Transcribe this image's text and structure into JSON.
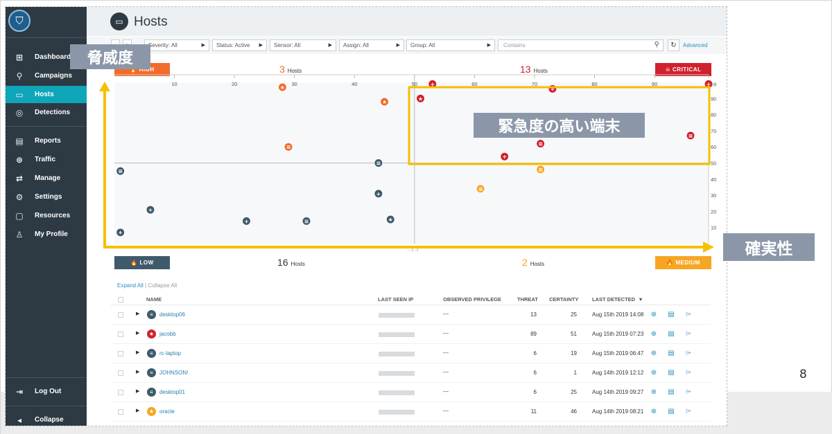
{
  "sidebar": {
    "logo_icon": "shield-logo-icon",
    "items": [
      {
        "label": "Dashboard",
        "icon": "dashboard-icon",
        "glyph": "⊞"
      },
      {
        "label": "Campaigns",
        "icon": "campaigns-icon",
        "glyph": "⚲"
      },
      {
        "label": "Hosts",
        "icon": "monitor-icon",
        "glyph": "▭",
        "active": true
      },
      {
        "label": "Detections",
        "icon": "target-icon",
        "glyph": "◎"
      },
      {
        "label": "Reports",
        "icon": "report-icon",
        "glyph": "▤"
      },
      {
        "label": "Traffic",
        "icon": "traffic-icon",
        "glyph": "⊛"
      },
      {
        "label": "Manage",
        "icon": "manage-icon",
        "glyph": "⇄"
      },
      {
        "label": "Settings",
        "icon": "gear-icon",
        "glyph": "⚙"
      },
      {
        "label": "Resources",
        "icon": "book-icon",
        "glyph": "▢"
      },
      {
        "label": "My Profile",
        "icon": "user-icon",
        "glyph": "♙"
      }
    ],
    "logout": {
      "label": "Log Out",
      "icon": "logout-icon",
      "glyph": "⇥"
    },
    "collapse": {
      "label": "Collapse",
      "icon": "collapse-icon",
      "glyph": "◂"
    }
  },
  "header": {
    "title": "Hosts",
    "icon": "monitor-icon"
  },
  "filters": {
    "star_icon": "star-icon",
    "target_icon": "target-icon",
    "severity": "Severity: All",
    "status": "Status: Active",
    "sensor": "Sensor: All",
    "assign": "Assign: All",
    "group": "Group: All",
    "search_placeholder": "Contains",
    "advanced": "Advanced"
  },
  "quadrants": {
    "high": {
      "label": "HIGH",
      "count": "3",
      "unit": "Hosts",
      "color": "#f26b2c"
    },
    "critical": {
      "label": "CRITICAL",
      "count": "13",
      "unit": "Hosts",
      "color": "#d0212e"
    },
    "low": {
      "label": "LOW",
      "count": "16",
      "unit": "Hosts",
      "color": "#3e5a6b"
    },
    "medium": {
      "label": "MEDIUM",
      "count": "2",
      "unit": "Hosts",
      "color": "#f6a623"
    }
  },
  "chart_data": {
    "type": "scatter",
    "x_ticks": [
      "10",
      "20",
      "30",
      "40",
      "50",
      "60",
      "70",
      "80",
      "90",
      "99"
    ],
    "y_ticks": [
      "99",
      "90",
      "80",
      "70",
      "60",
      "50",
      "40",
      "30",
      "20",
      "10"
    ],
    "xlim": [
      0,
      99
    ],
    "ylim": [
      0,
      100
    ],
    "xlabel": "",
    "partial_label": "... (...)",
    "points": [
      {
        "x": 28,
        "y": 97,
        "sev": "high",
        "icon": "star-icon"
      },
      {
        "x": 45,
        "y": 88,
        "sev": "high",
        "icon": "star-icon"
      },
      {
        "x": 29,
        "y": 60,
        "sev": "high",
        "icon": "server-icon"
      },
      {
        "x": 53,
        "y": 99,
        "sev": "critical",
        "icon": "plus-icon"
      },
      {
        "x": 51,
        "y": 90,
        "sev": "critical",
        "icon": "star-icon"
      },
      {
        "x": 73,
        "y": 96,
        "sev": "critical",
        "icon": "plus-icon"
      },
      {
        "x": 99,
        "y": 99,
        "sev": "critical",
        "icon": "plus-icon"
      },
      {
        "x": 71,
        "y": 62,
        "sev": "critical",
        "icon": "server-icon"
      },
      {
        "x": 96,
        "y": 67,
        "sev": "critical",
        "icon": "server-icon"
      },
      {
        "x": 65,
        "y": 54,
        "sev": "critical",
        "icon": "plus-icon"
      },
      {
        "x": 71,
        "y": 46,
        "sev": "medium",
        "icon": "server-icon"
      },
      {
        "x": 61,
        "y": 34,
        "sev": "medium",
        "icon": "server-icon"
      },
      {
        "x": 1,
        "y": 45,
        "sev": "low",
        "icon": "server-icon"
      },
      {
        "x": 44,
        "y": 50,
        "sev": "low",
        "icon": "server-icon"
      },
      {
        "x": 6,
        "y": 21,
        "sev": "low",
        "icon": "plus-icon"
      },
      {
        "x": 44,
        "y": 31,
        "sev": "low",
        "icon": "plus-icon"
      },
      {
        "x": 22,
        "y": 14,
        "sev": "low",
        "icon": "plus-icon"
      },
      {
        "x": 32,
        "y": 14,
        "sev": "low",
        "icon": "server-icon"
      },
      {
        "x": 46,
        "y": 15,
        "sev": "low",
        "icon": "star-icon"
      },
      {
        "x": 1,
        "y": 7,
        "sev": "low",
        "icon": "plus-icon"
      }
    ]
  },
  "table": {
    "expand_all": "Expand All",
    "separator": "|",
    "collapse_all": "Collapse All",
    "columns": [
      "NAME",
      "LAST SEEN IP",
      "OBSERVED PRIVILEGE",
      "THREAT",
      "CERTAINTY",
      "LAST DETECTED"
    ],
    "sort_icon": "caret-down-icon",
    "rows": [
      {
        "name": "desktop06",
        "privilege": "—",
        "threat": "13",
        "certainty": "25",
        "date": "Aug 15th 2019 14:08",
        "icon": "server-icon",
        "sev": "low"
      },
      {
        "name": "jacobb",
        "privilege": "—",
        "threat": "89",
        "certainty": "51",
        "date": "Aug 15th 2019 07:23",
        "icon": "star-icon",
        "sev": "critical"
      },
      {
        "name": "rc-laptop",
        "privilege": "—",
        "threat": "6",
        "certainty": "19",
        "date": "Aug 15th 2019 06:47",
        "icon": "server-icon",
        "sev": "low"
      },
      {
        "name": "JOHNSON!",
        "privilege": "—",
        "threat": "6",
        "certainty": "1",
        "date": "Aug 14th 2019 12:12",
        "icon": "server-icon",
        "sev": "low"
      },
      {
        "name": "desktop01",
        "privilege": "—",
        "threat": "6",
        "certainty": "25",
        "date": "Aug 14th 2019 09:27",
        "icon": "server-icon",
        "sev": "low"
      },
      {
        "name": "oracle",
        "privilege": "—",
        "threat": "11",
        "certainty": "46",
        "date": "Aug 14th 2019 08:21",
        "icon": "star-icon",
        "sev": "medium"
      }
    ],
    "actions": [
      "crosshair-icon",
      "clipboard-icon",
      "tag-icon"
    ]
  },
  "annotations": {
    "threat_label": "脅威度",
    "certainty_label": "確実性",
    "critical_box_label": "緊急度の高い端末",
    "arrow_color": "#f5c000",
    "callout_color": "#8b97a9"
  },
  "page_number": "8"
}
